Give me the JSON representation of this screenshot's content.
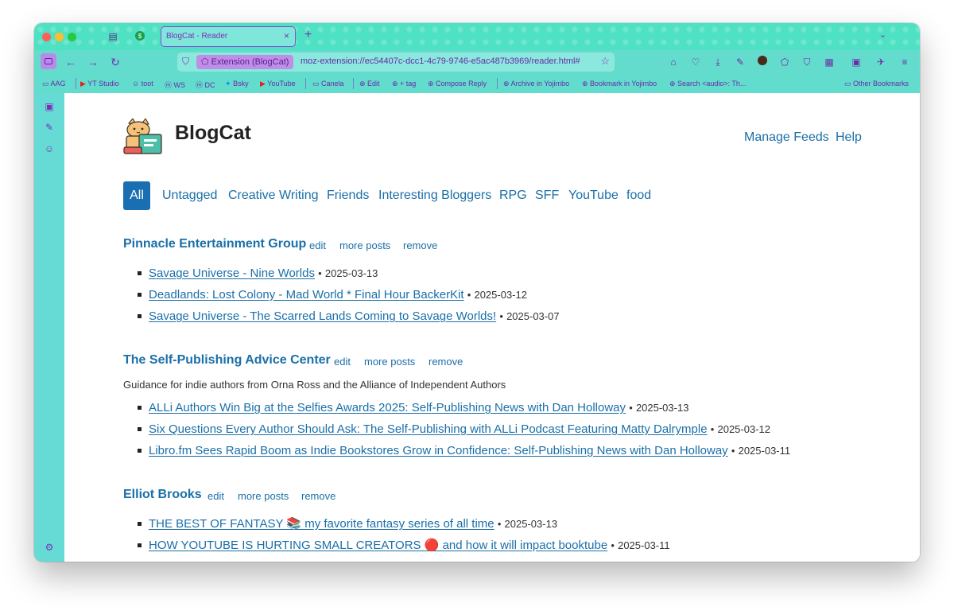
{
  "browser": {
    "tab_title": "BlogCat - Reader",
    "tab_close": "×",
    "new_tab": "+",
    "extension_label": "Extension (BlogCat)",
    "url": "moz-extension://ec54407c-dcc1-4c79-9746-e5ac487b3969/reader.html#",
    "accent_color": "#7a2fb6",
    "chrome_color": "#4fe1c3"
  },
  "bookmarks": [
    {
      "label": "AAG",
      "icon": "folder-icon"
    },
    {
      "label": "YT Studio",
      "icon": "youtube-icon"
    },
    {
      "label": "toot",
      "icon": "mastodon-icon"
    },
    {
      "label": "WS",
      "icon": "mastodon-icon"
    },
    {
      "label": "DC",
      "icon": "mastodon-icon"
    },
    {
      "label": "Bsky",
      "icon": "butterfly-icon"
    },
    {
      "label": "YouTube",
      "icon": "youtube-icon"
    },
    {
      "label": "Canela",
      "icon": "folder-icon"
    },
    {
      "label": "Edit",
      "icon": "globe-icon"
    },
    {
      "label": "+ tag",
      "icon": "globe-icon"
    },
    {
      "label": "Compose Reply",
      "icon": "globe-icon"
    },
    {
      "label": "Archive in Yojimbo",
      "icon": "globe-icon"
    },
    {
      "label": "Bookmark in Yojimbo",
      "icon": "globe-icon"
    },
    {
      "label": "Search <audio>: Th...",
      "icon": "globe-icon"
    },
    {
      "label": "Other Bookmarks",
      "icon": "folder-icon"
    }
  ],
  "app": {
    "name": "BlogCat",
    "nav": {
      "manage_feeds": "Manage Feeds",
      "help": "Help"
    }
  },
  "filters": [
    "All",
    "Untagged",
    "Creative Writing",
    "Friends",
    "Interesting Bloggers",
    "RPG",
    "SFF",
    "YouTube",
    "food"
  ],
  "feed_actions": {
    "edit": "edit",
    "more": "more posts",
    "remove": "remove"
  },
  "separator": "•",
  "feeds": [
    {
      "title": "Pinnacle Entertainment Group",
      "description": "",
      "posts": [
        {
          "title": "Savage Universe - Nine Worlds",
          "date": "2025-03-13"
        },
        {
          "title": "Deadlands: Lost Colony - Mad World * Final Hour BackerKit",
          "date": "2025-03-12"
        },
        {
          "title": "Savage Universe - The Scarred Lands Coming to Savage Worlds!",
          "date": "2025-03-07"
        }
      ]
    },
    {
      "title": "The Self-Publishing Advice Center",
      "description": "Guidance for indie authors from Orna Ross and the Alliance of Independent Authors",
      "posts": [
        {
          "title": "ALLi Authors Win Big at the Selfies Awards 2025: Self-Publishing News with Dan Holloway",
          "date": "2025-03-13"
        },
        {
          "title": "Six Questions Every Author Should Ask: The Self-Publishing with ALLi Podcast Featuring Matty Dalrymple",
          "date": "2025-03-12"
        },
        {
          "title": "Libro.fm Sees Rapid Boom as Indie Bookstores Grow in Confidence: Self-Publishing News with Dan Holloway",
          "date": "2025-03-11"
        }
      ]
    },
    {
      "title": "Elliot Brooks",
      "description": "",
      "posts": [
        {
          "title": "THE BEST OF FANTASY 📚 my favorite fantasy series of all time",
          "date": "2025-03-13"
        },
        {
          "title": "HOW YOUTUBE IS HURTING SMALL CREATORS 🔴 and how it will impact booktube",
          "date": "2025-03-11"
        }
      ]
    }
  ]
}
